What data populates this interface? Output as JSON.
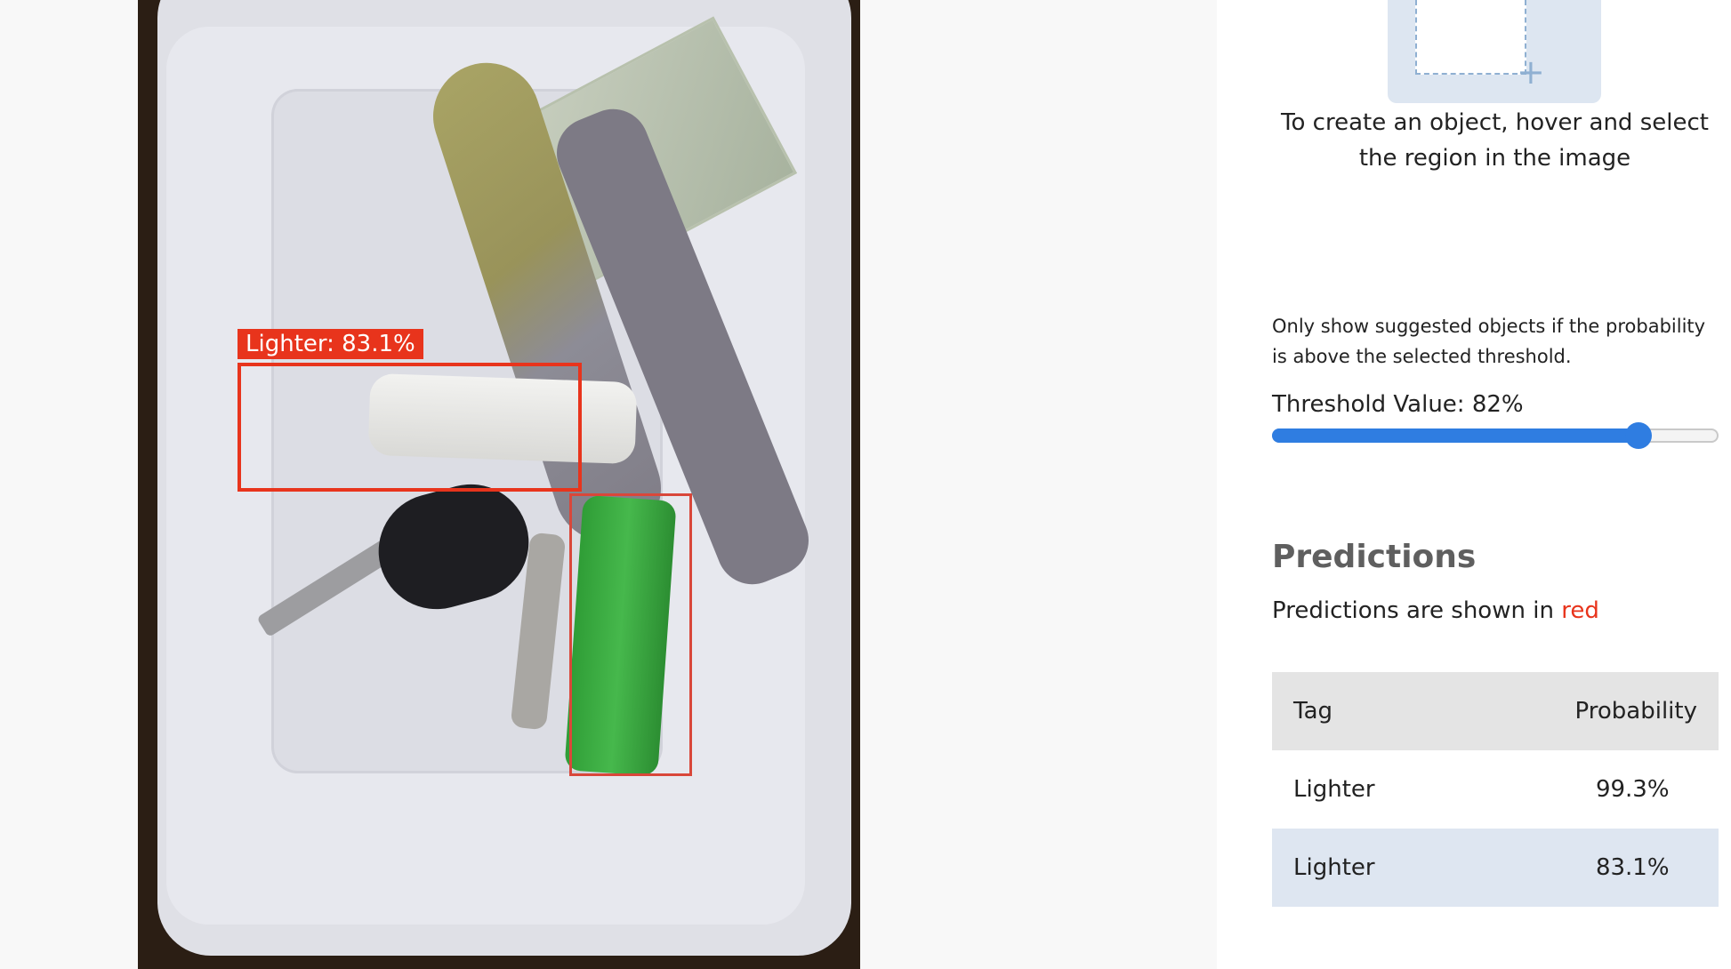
{
  "canvas": {
    "image_alt": "Tray with keys, a dollar bill, a lanyard, a white lighter and a green lighter",
    "detections": [
      {
        "label": "Lighter: 83.1%",
        "color": "#e8341c"
      }
    ]
  },
  "panel": {
    "draw_hint": {
      "icon": "plus-icon",
      "text": "To create an object, hover and select the region in the image"
    },
    "threshold": {
      "description": "Only show suggested objects if the probability is above the selected threshold.",
      "label": "Threshold Value: 82%",
      "value_percent": 82
    },
    "predictions": {
      "title": "Predictions",
      "subtitle_prefix": "Predictions are shown in",
      "subtitle_color_word": "red",
      "accent_color": "#e8341c",
      "columns": {
        "tag": "Tag",
        "probability": "Probability"
      },
      "rows": [
        {
          "tag": "Lighter",
          "probability": "99.3%"
        },
        {
          "tag": "Lighter",
          "probability": "83.1%"
        }
      ]
    }
  }
}
